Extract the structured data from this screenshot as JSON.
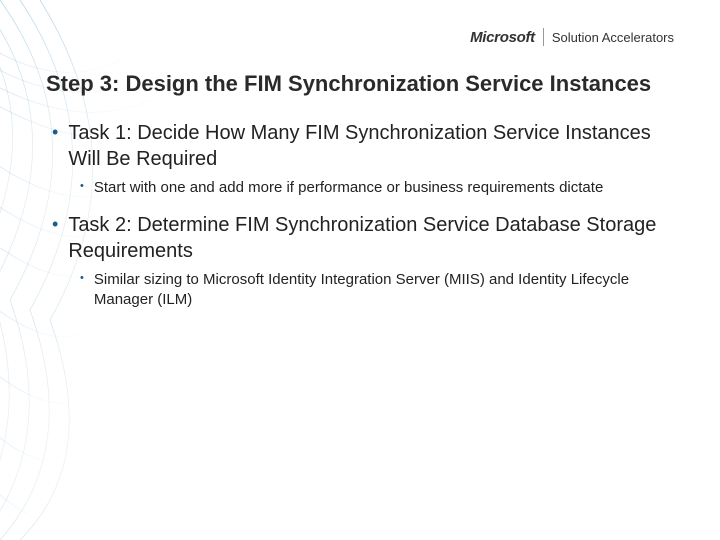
{
  "logo": {
    "brand": "Microsoft",
    "product": "Solution Accelerators"
  },
  "slide": {
    "title": "Step 3: Design the FIM Synchronization Service Instances",
    "bullets": [
      {
        "text": "Task 1: Decide How Many FIM Synchronization Service Instances Will Be Required",
        "sub": [
          {
            "text": "Start with one and add more if performance or business requirements dictate"
          }
        ]
      },
      {
        "text": "Task 2: Determine FIM Synchronization Service Database Storage Requirements",
        "sub": [
          {
            "text": "Similar sizing to Microsoft Identity Integration Server (MIIS) and Identity Lifecycle Manager (ILM)"
          }
        ]
      }
    ]
  }
}
